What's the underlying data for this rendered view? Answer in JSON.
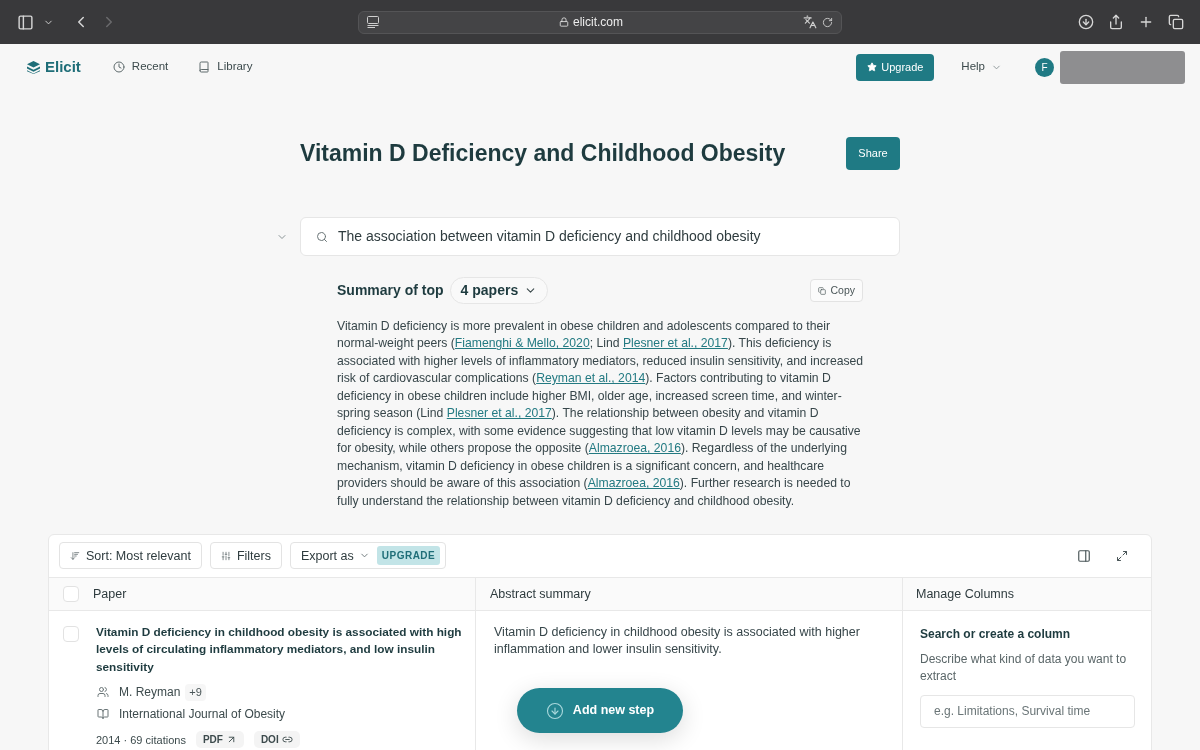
{
  "browser": {
    "url": "elicit.com",
    "back": {
      "disabled": false
    },
    "forward": {
      "disabled": true
    }
  },
  "nav": {
    "logo": "Elicit",
    "links": [
      {
        "kind": "recent",
        "label": "Recent"
      },
      {
        "kind": "library",
        "label": "Library"
      }
    ],
    "upgrade": "Upgrade",
    "help": "Help",
    "avatar": "F"
  },
  "page": {
    "title": "Vitamin D Deficiency and Childhood Obesity",
    "share": "Share"
  },
  "query": {
    "value": "The association between vitamin D deficiency and childhood obesity"
  },
  "summary": {
    "heading": "Summary of top",
    "papers": "4 papers",
    "copy": "Copy",
    "segments": [
      {
        "kind": "text",
        "text": "Vitamin D deficiency is more prevalent in obese children and adolescents compared to their normal-weight peers ("
      },
      {
        "kind": "citation",
        "text": "Fiamenghi & Mello, 2020"
      },
      {
        "kind": "text",
        "text": "; Lind "
      },
      {
        "kind": "citation",
        "text": "Plesner et al., 2017"
      },
      {
        "kind": "text",
        "text": "). This deficiency is associated with higher levels of inflammatory mediators, reduced insulin sensitivity, and increased risk of cardiovascular complications ("
      },
      {
        "kind": "citation",
        "text": "Reyman et al., 2014"
      },
      {
        "kind": "text",
        "text": "). Factors contributing to vitamin D deficiency in obese children include higher BMI, older age, increased screen time, and winter-spring season (Lind "
      },
      {
        "kind": "citation",
        "text": "Plesner et al., 2017"
      },
      {
        "kind": "text",
        "text": "). The relationship between obesity and vitamin D deficiency is complex, with some evidence suggesting that low vitamin D levels may be causative for obesity, while others propose the opposite ("
      },
      {
        "kind": "citation",
        "text": "Almazroea, 2016"
      },
      {
        "kind": "text",
        "text": "). Regardless of the underlying mechanism, vitamin D deficiency in obese children is a significant concern, and healthcare providers should be aware of this association ("
      },
      {
        "kind": "citation",
        "text": "Almazroea, 2016"
      },
      {
        "kind": "text",
        "text": "). Further research is needed to fully understand the relationship between vitamin D deficiency and childhood obesity."
      }
    ]
  },
  "toolbar": {
    "sort": "Sort: Most relevant",
    "filters": "Filters",
    "export": "Export as",
    "export_badge": "UPGRADE"
  },
  "table": {
    "select_all_checked": false,
    "columns": [
      "Paper",
      "Abstract summary",
      "Manage Columns"
    ],
    "rows": [
      {
        "checked": false,
        "title": "Vitamin D deficiency in childhood obesity is associated with high levels of circulating inflammatory mediators, and low insulin sensitivity",
        "author": "M. Reyman",
        "more_authors": "+9",
        "journal": "International Journal of Obesity",
        "meta": "2014 · 69 citations",
        "links": [
          {
            "kind": "external",
            "label": "PDF"
          },
          {
            "kind": "link",
            "label": "DOI"
          }
        ],
        "abstract": "Vitamin D deficiency in childhood obesity is associated with higher inflammation and lower insulin sensitivity."
      }
    ]
  },
  "manage_columns": {
    "heading": "Search or create a column",
    "description": "Describe what kind of data you want to extract",
    "placeholder": "e.g. Limitations, Survival time"
  },
  "add_step": "Add new step"
}
